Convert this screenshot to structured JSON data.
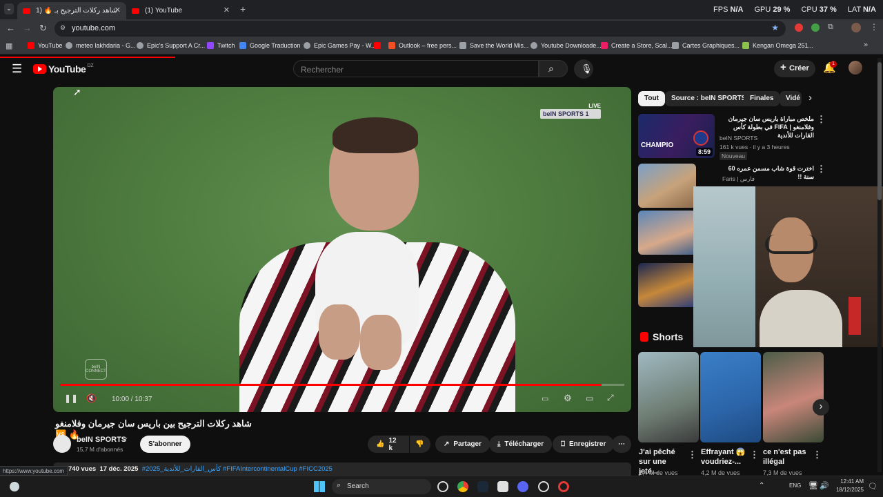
{
  "browser": {
    "tabs": [
      {
        "title": "شاهد ركلات الترجيح بـ 🔥 🆚 (1)",
        "active": true
      },
      {
        "title": "(1) YouTube",
        "active": false
      }
    ],
    "new_tab": "+",
    "perf": {
      "fps_label": "FPS",
      "fps": "N/A",
      "gpu_label": "GPU",
      "gpu": "29 %",
      "cpu_label": "CPU",
      "cpu": "37 %",
      "lat_label": "LAT",
      "lat": "N/A"
    },
    "url": "youtube.com",
    "bookmarks": [
      {
        "label": "YouTube",
        "color": "#ff0000"
      },
      {
        "label": "meteo lakhdaria - G...",
        "color": "#9aa0a6"
      },
      {
        "label": "Epic's Support A Cr...",
        "color": "#9aa0a6"
      },
      {
        "label": "Twitch",
        "color": "#9146ff"
      },
      {
        "label": "Google Traduction",
        "color": "#4285f4"
      },
      {
        "label": "Epic Games Pay - W...",
        "color": "#9aa0a6"
      },
      {
        "label": "",
        "color": "#ff0000"
      },
      {
        "label": "Outlook – free pers...",
        "color": "#f25022"
      },
      {
        "label": "Save the World Mis...",
        "color": "#9aa0a6"
      },
      {
        "label": "Youtube Downloade...",
        "color": "#9aa0a6"
      },
      {
        "label": "Create a Store, Scal...",
        "color": "#e91e63"
      },
      {
        "label": "Cartes Graphiques...",
        "color": "#9aa0a6"
      },
      {
        "label": "Kengan Omega 251...",
        "color": "#8bc34a"
      }
    ],
    "status_url": "https://www.youtube.com"
  },
  "youtube": {
    "logo": "YouTube",
    "country": "DZ",
    "search_placeholder": "Rechercher",
    "create_label": "Créer",
    "notif_count": "1",
    "video": {
      "channel_tag": "beIN SPORTS",
      "live_tag": "LIVE",
      "channel_number": "1",
      "connect_label": "beIN CONNECT",
      "time": "10:00 / 10:37",
      "progress_fraction": 0.96,
      "title": "شاهد ركلات الترجيح بين باريس سان جيرمان وفلامنغو 🔥 🆚",
      "channel": "beIN SPORTS",
      "subscribers": "15,7 M d'abonnés",
      "subscribe_label": "S'abonner",
      "likes": "12 k",
      "share_label": "Partager",
      "download_label": "Télécharger",
      "save_label": "Enregistrer",
      "views": "740 vues",
      "date": "17 déc. 2025",
      "hashtags": "#كأس_القارات_للأندية_2025  #FIFAIntercontinentalCup  #FICC2025"
    },
    "chips": [
      "Tout",
      "Source : beIN SPORTS",
      "Finales",
      "Vidé"
    ],
    "recommendations": [
      {
        "title": "ملخص مباراة باريس سان جيرمان وفلامنغو | FIFA في بطولة كأس القارات للأندية",
        "channel": "beIN SPORTS",
        "meta": "161 k vues · il y a 3 heures",
        "badge": "Nouveau",
        "duration": "8:59",
        "thumb_label": "CHAMPIO"
      },
      {
        "title": "اخترت قوة شاب مسمن عمره 60 سنة !!",
        "channel": "Faris | فارس",
        "meta": "",
        "badge": "",
        "duration": "",
        "thumb_label": ""
      }
    ],
    "shorts_label": "Shorts",
    "shorts": [
      {
        "title": "J'ai pêché sur une jeté...",
        "views": "1,4 M de vues"
      },
      {
        "title": "Effrayant 😱 voudriez-...",
        "views": "4,2 M de vues"
      },
      {
        "title": "ce n'est pas illégal",
        "views": "7,3 M de vues"
      }
    ]
  },
  "taskbar": {
    "search_label": "Search",
    "lang": "ENG",
    "time": "12:41 AM",
    "date": "18/12/2025"
  }
}
